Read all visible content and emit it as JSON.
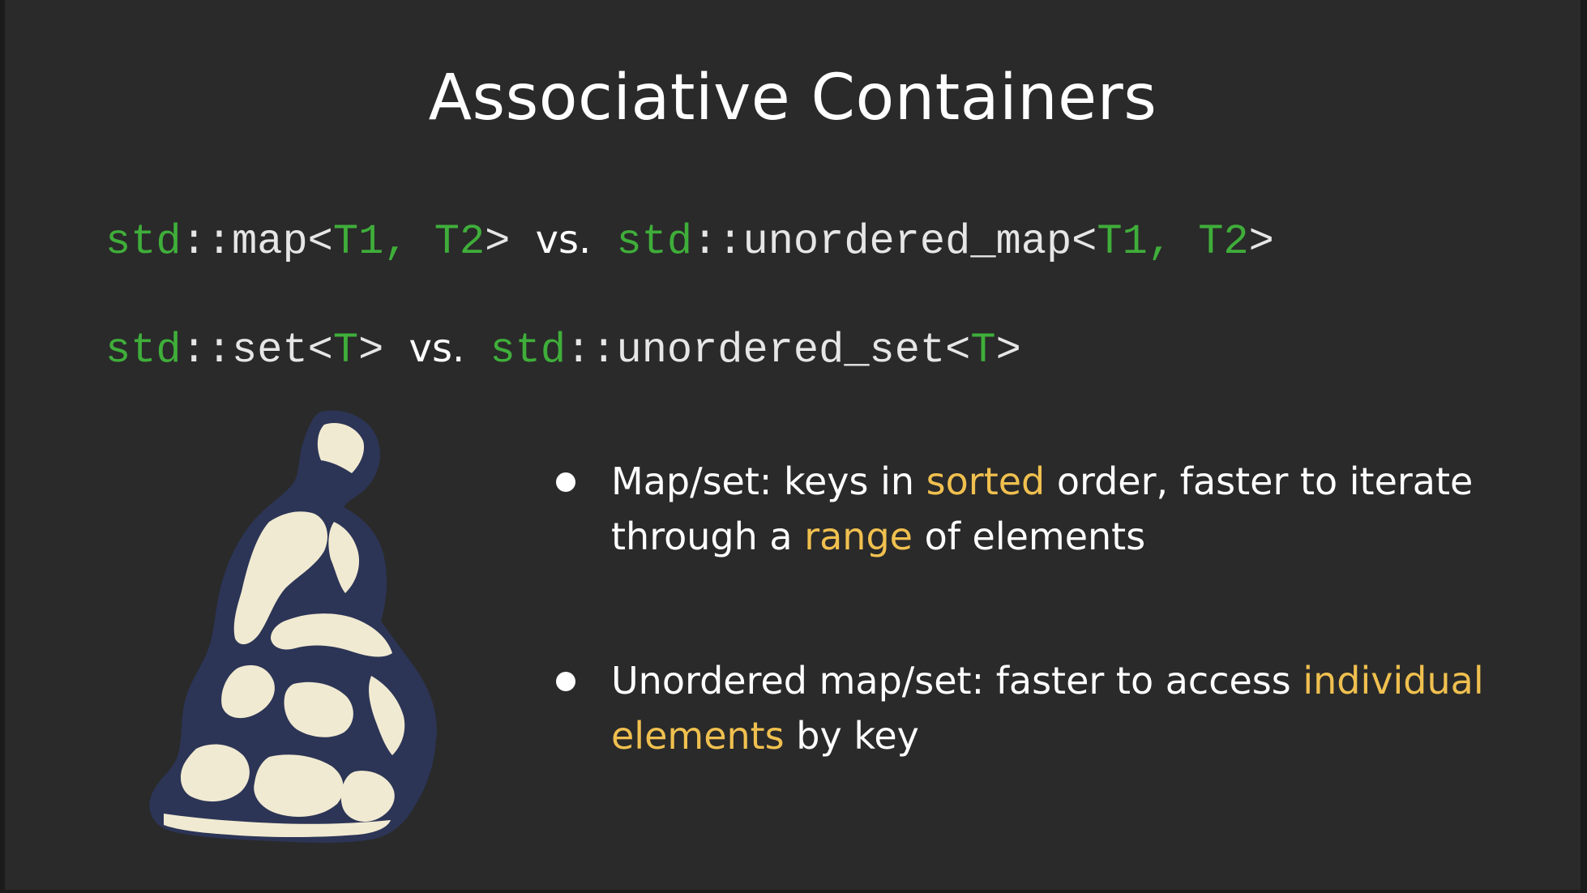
{
  "slide": {
    "title": "Associative Containers",
    "code_lines": [
      {
        "left": {
          "ns": "std",
          "sep": "::",
          "name": "map",
          "open": "<",
          "args": "T1, T2",
          "close": ">"
        },
        "vs": "vs.",
        "right": {
          "ns": "std",
          "sep": "::",
          "name": "unordered_map",
          "open": "<",
          "args": "T1, T2",
          "close": ">"
        }
      },
      {
        "left": {
          "ns": "std",
          "sep": "::",
          "name": "set",
          "open": "<",
          "args": "T",
          "close": ">"
        },
        "vs": "vs.",
        "right": {
          "ns": "std",
          "sep": "::",
          "name": "unordered_set",
          "open": "<",
          "args": "T",
          "close": ">"
        }
      }
    ],
    "bullets": [
      {
        "parts": [
          "Map/set: keys in ",
          "sorted",
          " order, faster to iterate through a ",
          "range",
          " of elements"
        ]
      },
      {
        "parts": [
          "Unordered map/set: faster to access ",
          "individual elements",
          " by key"
        ]
      }
    ],
    "image": {
      "icon": "thinker-statue-illustration"
    },
    "colors": {
      "background": "#2a2a2a",
      "code_keyword": "#3fae3a",
      "highlight": "#f0c04f",
      "text": "#ffffff"
    }
  }
}
